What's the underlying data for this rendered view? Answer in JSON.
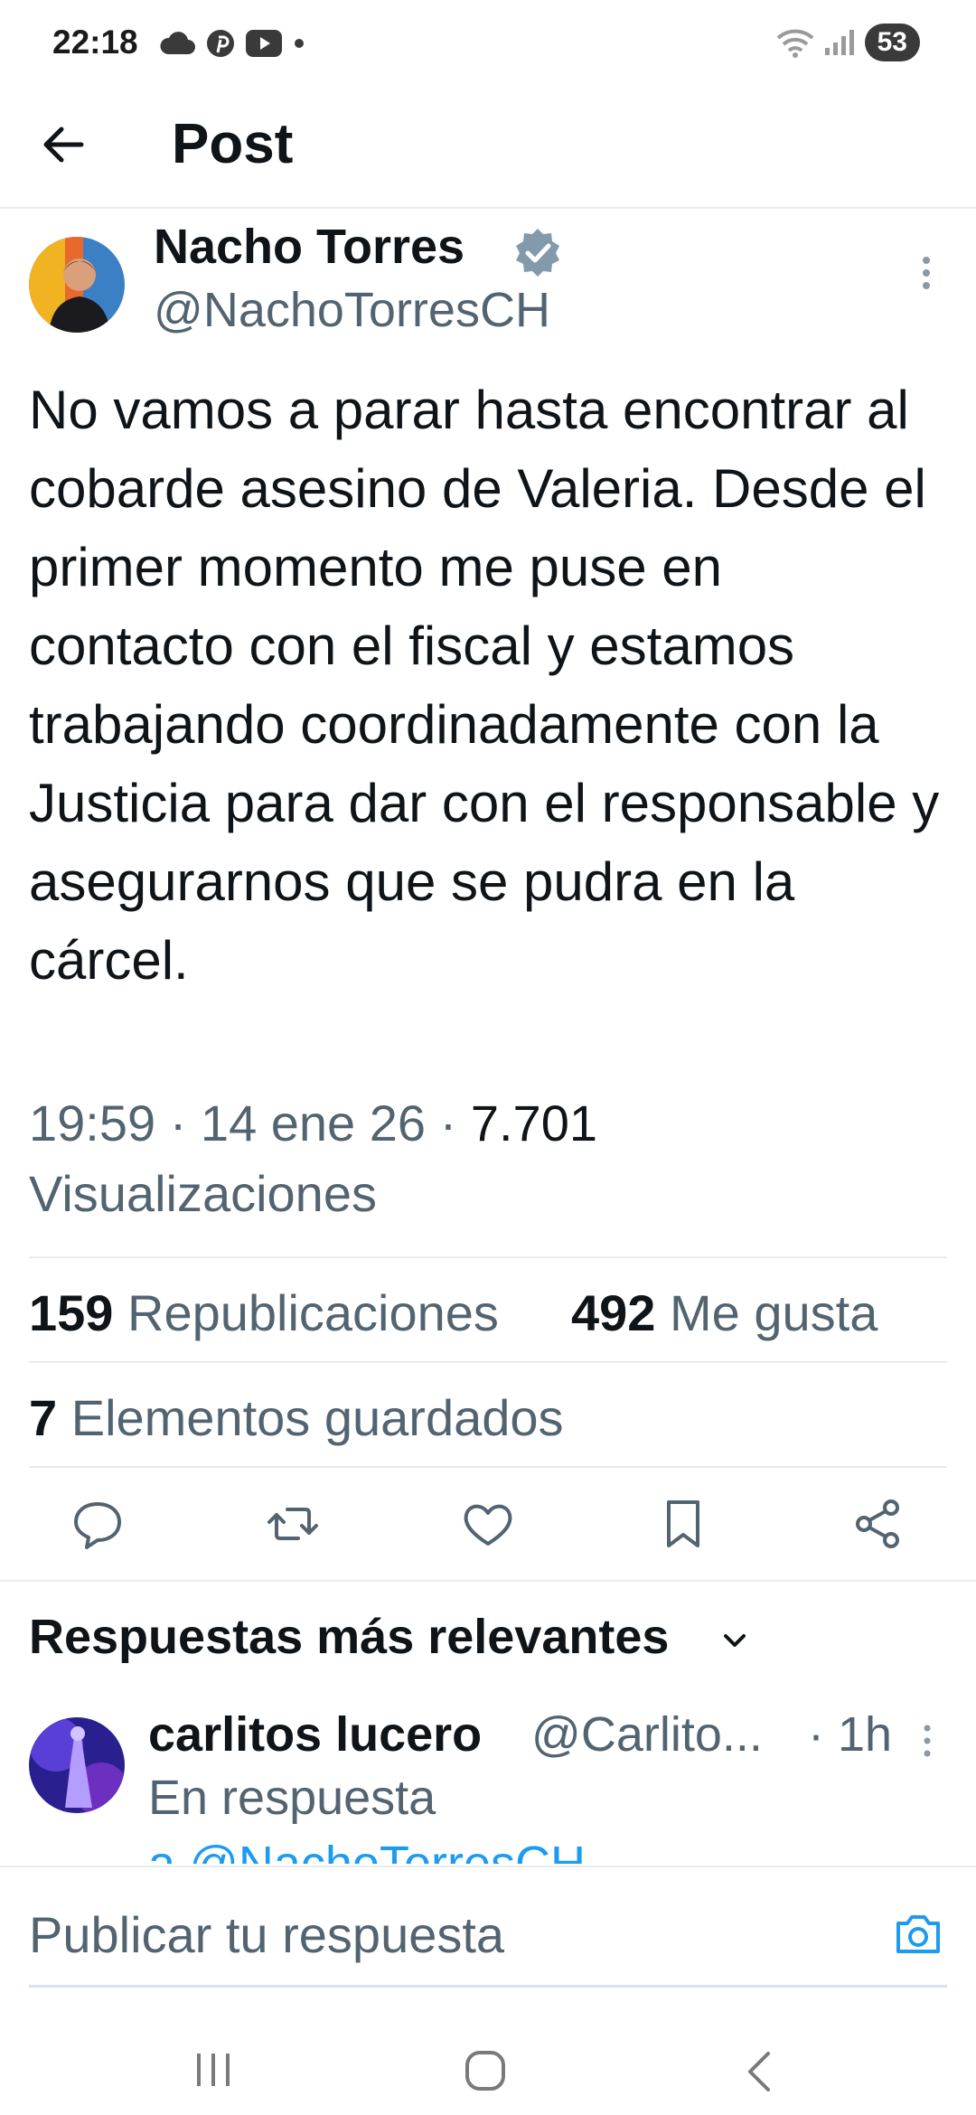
{
  "status_bar": {
    "time": "22:18",
    "battery": "53",
    "icons": [
      "cloud-icon",
      "pinterest-icon",
      "youtube-icon",
      "dot-icon",
      "wifi-icon",
      "signal-icon"
    ]
  },
  "header": {
    "title": "Post"
  },
  "author": {
    "name": "Nacho Torres",
    "handle": "@NachoTorresCH"
  },
  "tweet": {
    "text": "No vamos a parar hasta encontrar al cobarde asesino de Valeria. Desde el primer momento me puse en contacto con el fiscal y estamos trabajando coordinadamente con la Justicia para dar con el responsable y asegurarnos que se pudra en la cárcel.",
    "time": "19:59",
    "date": "14 ene 26",
    "views": "7.701",
    "views_label": "Visualizaciones"
  },
  "stats": {
    "reposts_count": "159",
    "reposts_label": "Republicaciones",
    "likes_count": "492",
    "likes_label": "Me gusta",
    "bookmarks_count": "7",
    "bookmarks_label": "Elementos guardados"
  },
  "replies_section": {
    "title": "Respuestas más relevantes"
  },
  "reply": {
    "name": "carlitos lucero",
    "handle": "@Carlito...",
    "time": "· 1h",
    "in_reply_label": "En respuesta",
    "mention": "a @NachoTorresCH"
  },
  "composer": {
    "placeholder": "Publicar tu respuesta"
  },
  "colors": {
    "accent": "#1d9bf0",
    "secondary_text": "#536471",
    "verified": "#829aab"
  }
}
